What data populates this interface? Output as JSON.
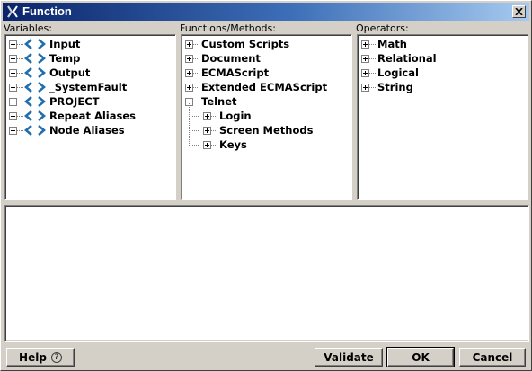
{
  "window": {
    "title": "Function",
    "close_glyph": "✕"
  },
  "panes": {
    "variables": {
      "label": "Variables:",
      "items": [
        {
          "label": "Input",
          "icon": "variable-icon"
        },
        {
          "label": "Temp",
          "icon": "variable-icon"
        },
        {
          "label": "Output",
          "icon": "variable-icon"
        },
        {
          "label": "_SystemFault",
          "icon": "variable-icon"
        },
        {
          "label": "PROJECT",
          "icon": "variable-icon"
        },
        {
          "label": "Repeat Aliases",
          "icon": "variable-icon"
        },
        {
          "label": "Node Aliases",
          "icon": "variable-icon"
        }
      ]
    },
    "functions": {
      "label": "Functions/Methods:",
      "items": [
        {
          "label": "Custom Scripts"
        },
        {
          "label": "Document"
        },
        {
          "label": "ECMAScript"
        },
        {
          "label": "Extended ECMAScript"
        },
        {
          "label": "Telnet",
          "expanded": true
        },
        {
          "label": "Login",
          "child": true
        },
        {
          "label": "Screen Methods",
          "child": true
        },
        {
          "label": "Keys",
          "child": true
        }
      ]
    },
    "operators": {
      "label": "Operators:",
      "items": [
        {
          "label": "Math"
        },
        {
          "label": "Relational"
        },
        {
          "label": "Logical"
        },
        {
          "label": "String"
        }
      ]
    }
  },
  "editor": {
    "value": ""
  },
  "buttons": {
    "help": "Help",
    "help_glyph": "?",
    "validate": "Validate",
    "ok": "OK",
    "cancel": "Cancel"
  },
  "colors": {
    "titlebar_start": "#0a246a",
    "titlebar_end": "#a6caf0",
    "variable_icon": "#1f6fb0",
    "window_bg": "#d4d0c8"
  }
}
